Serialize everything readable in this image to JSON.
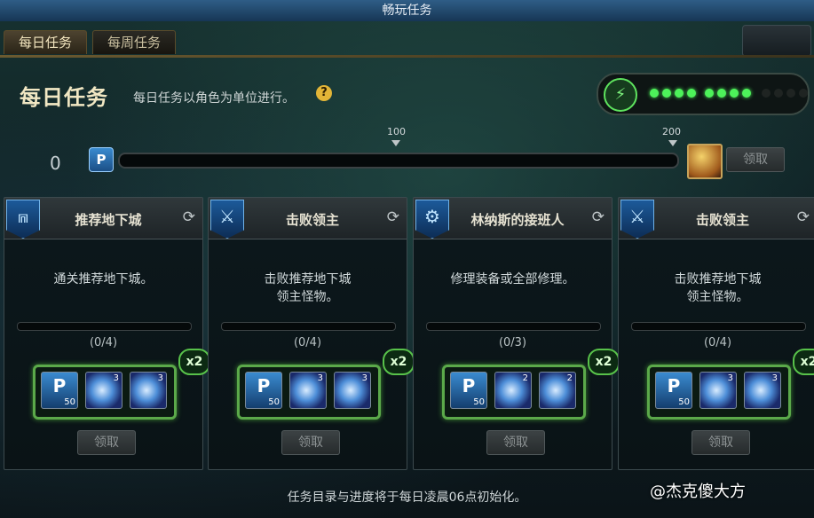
{
  "window": {
    "title": "畅玩任务"
  },
  "tabs": [
    {
      "label": "每日任务",
      "active": true
    },
    {
      "label": "每周任务",
      "active": false
    }
  ],
  "header": {
    "title": "每日任务",
    "subtitle": "每日任务以角色为单位进行。",
    "help_icon": "?"
  },
  "energy": {
    "icon": "battery-icon",
    "glyph": "⚡",
    "filled": 8,
    "total": 12
  },
  "progress": {
    "current_label": "0",
    "current": 0,
    "max": 200,
    "milestones": [
      {
        "label": "100",
        "value": 100
      },
      {
        "label": "200",
        "value": 200
      }
    ],
    "p_icon": "P",
    "claim_label": "领取"
  },
  "cards": [
    {
      "title": "推荐地下城",
      "icon": "gate-icon",
      "glyph": "⩎",
      "desc_lines": [
        "通关推荐地下城。"
      ],
      "count": "(0/4)",
      "p_value": "50",
      "orbs": [
        "3",
        "3"
      ],
      "multiplier": "x2",
      "claim_label": "领取"
    },
    {
      "title": "击败领主",
      "icon": "sword-icon",
      "glyph": "⚔",
      "desc_lines": [
        "击败推荐地下城",
        "领主怪物。"
      ],
      "count": "(0/4)",
      "p_value": "50",
      "orbs": [
        "3",
        "3"
      ],
      "multiplier": "x2",
      "claim_label": "领取"
    },
    {
      "title": "林纳斯的接班人",
      "icon": "gear-icon",
      "glyph": "⚙",
      "desc_lines": [
        "修理装备或全部修理。"
      ],
      "count": "(0/3)",
      "p_value": "50",
      "orbs": [
        "2",
        "2"
      ],
      "multiplier": "x2",
      "claim_label": "领取"
    },
    {
      "title": "击败领主",
      "icon": "sword-icon",
      "glyph": "⚔",
      "desc_lines": [
        "击败推荐地下城",
        "领主怪物。"
      ],
      "count": "(0/4)",
      "p_value": "50",
      "orbs": [
        "3",
        "3"
      ],
      "multiplier": "x2",
      "claim_label": "领取"
    }
  ],
  "refresh_glyph": "⟳",
  "footer": {
    "note": "任务目录与进度将于每日凌晨06点初始化。"
  },
  "watermark": "@杰克傻大方"
}
